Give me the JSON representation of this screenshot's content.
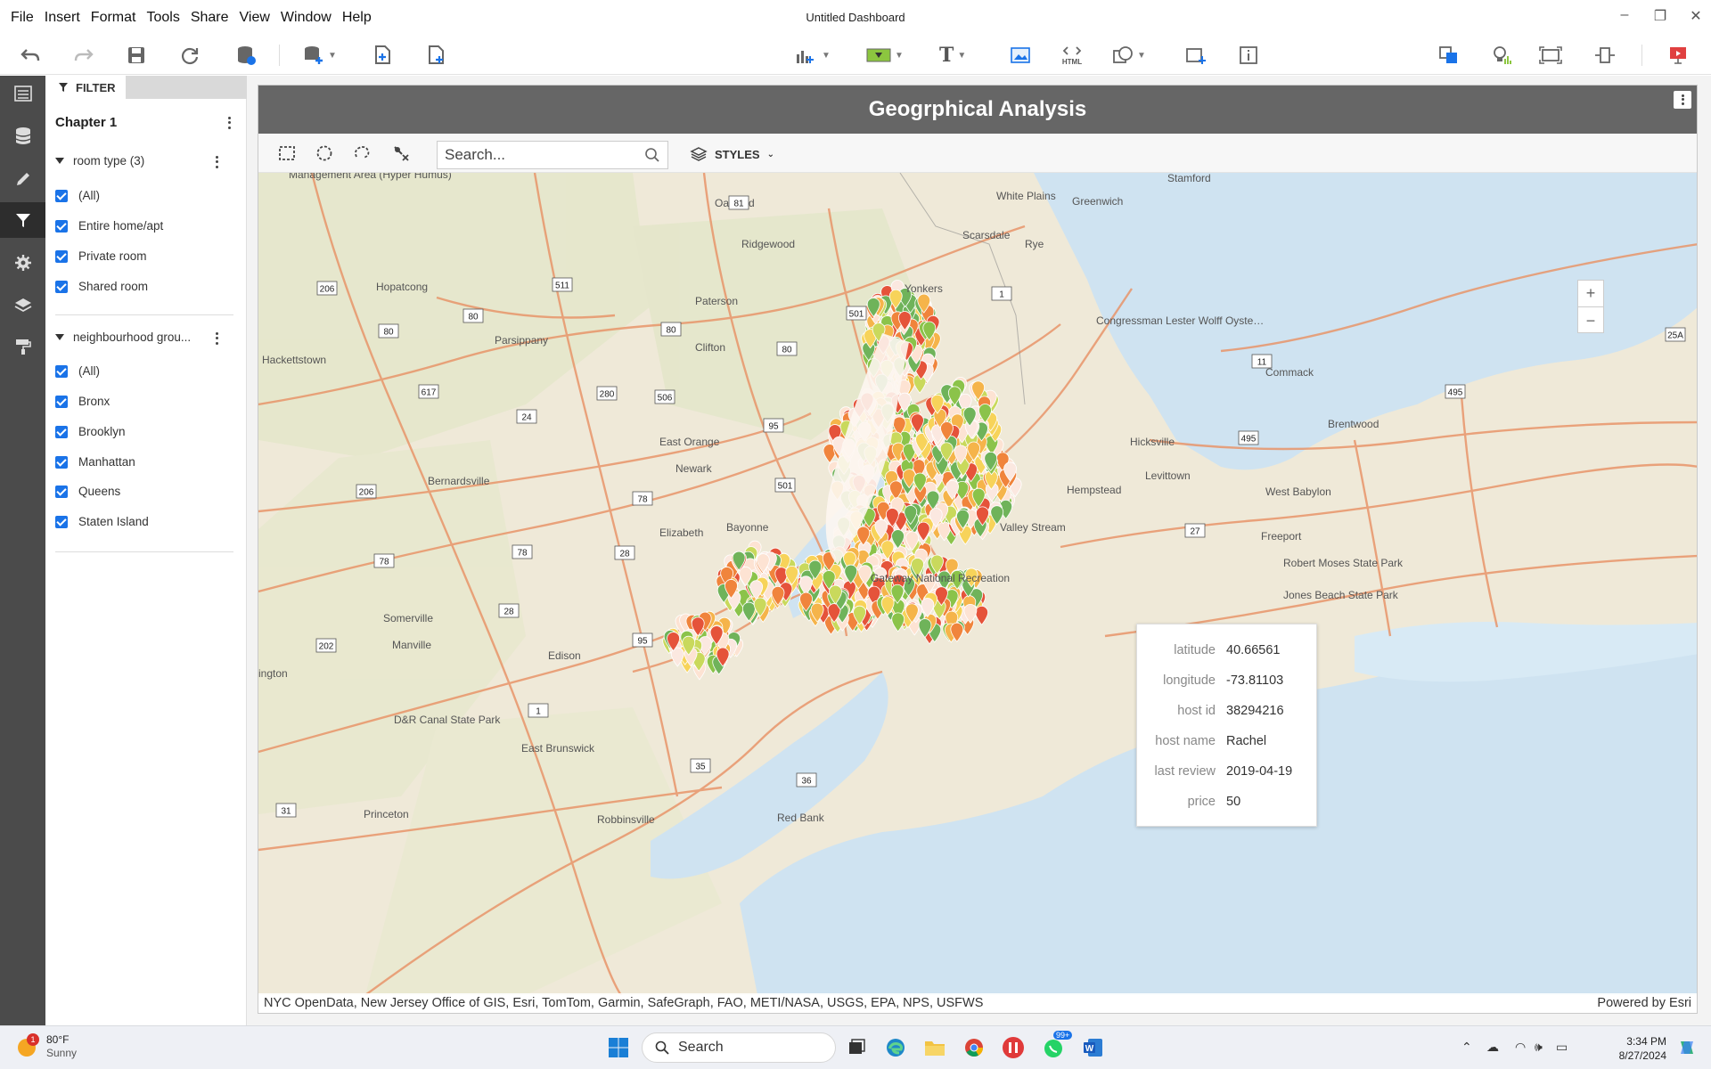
{
  "window": {
    "title": "Untitled Dashboard",
    "menu": [
      "File",
      "Insert",
      "Format",
      "Tools",
      "Share",
      "View",
      "Window",
      "Help"
    ]
  },
  "filter_panel": {
    "tab_label": "FILTER",
    "chapter": "Chapter 1",
    "groups": [
      {
        "title": "room type (3)",
        "items": [
          "(All)",
          "Entire home/apt",
          "Private room",
          "Shared room"
        ]
      },
      {
        "title": "neighbourhood grou...",
        "items": [
          "(All)",
          "Bronx",
          "Brooklyn",
          "Manhattan",
          "Queens",
          "Staten Island"
        ]
      }
    ]
  },
  "widget": {
    "title": "Geogrphical Analysis",
    "search_placeholder": "Search...",
    "styles_label": "STYLES",
    "attribution": "NYC OpenData, New Jersey Office of GIS, Esri, TomTom, Garmin, SafeGraph, FAO, METI/NASA, USGS, EPA, NPS, USFWS",
    "powered_by": "Powered by Esri",
    "zoom_in": "+",
    "zoom_out": "−"
  },
  "map_labels": {
    "places": [
      "Stamford",
      "White Plains",
      "Greenwich",
      "Oakland",
      "Ridgewood",
      "Scarsdale",
      "Rye",
      "Yonkers",
      "Hopatcong",
      "Paterson",
      "Clifton",
      "Parsippany",
      "Hackettstown",
      "Congressman Lester Wolff Oyster Bay National Wildlife Refuge",
      "Commack",
      "Hicksville",
      "Brentwood",
      "Levittown",
      "Hempstead",
      "West Babylon",
      "East Orange",
      "Newark",
      "Bernardsville",
      "Elizabeth",
      "Bayonne",
      "Valley Stream",
      "Freeport",
      "Robert Moses State Park",
      "Jones Beach State Park",
      "Gateway National Recreation",
      "Somerville",
      "Manville",
      "Edison",
      "D&R Canal State Park",
      "East Brunswick",
      "Princeton",
      "Robbinsville",
      "Red Bank",
      "Management Area (Hyper Humus)",
      "ington"
    ],
    "shields": [
      "81",
      "206",
      "511",
      "80",
      "80",
      "80",
      "80",
      "501",
      "1",
      "11",
      "495",
      "495",
      "25A",
      "617",
      "24",
      "280",
      "506",
      "95",
      "206",
      "501",
      "78",
      "78",
      "78",
      "28",
      "28",
      "202",
      "95",
      "1",
      "35",
      "36",
      "31",
      "27"
    ]
  },
  "popup": {
    "rows": [
      {
        "key": "latitude",
        "value": "40.66561"
      },
      {
        "key": "longitude",
        "value": "-73.81103"
      },
      {
        "key": "host id",
        "value": "38294216"
      },
      {
        "key": "host name",
        "value": "Rachel"
      },
      {
        "key": "last review",
        "value": "2019-04-19"
      },
      {
        "key": "price",
        "value": "50"
      }
    ]
  },
  "taskbar": {
    "weather_temp": "80°F",
    "weather_desc": "Sunny",
    "weather_badge": "1",
    "search": "Search",
    "notif_badge": "99+",
    "time": "3:34 PM",
    "date": "8/27/2024"
  },
  "colors": {
    "accent": "#1a73e8",
    "title_bar": "#666666",
    "rail": "#4b4b4b",
    "water": "#cfe3f1",
    "land": "#efe9d8",
    "road": "#e8956a"
  }
}
